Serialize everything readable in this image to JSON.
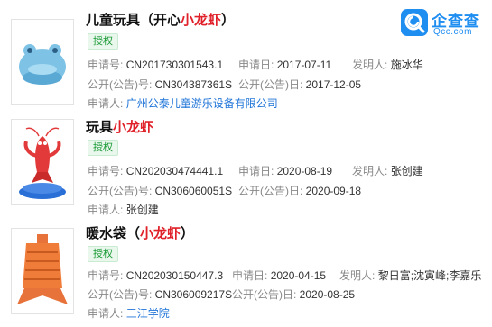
{
  "brand": {
    "name_cn": "企查查",
    "name_en": "Qcc.com",
    "color": "#1f8ef1"
  },
  "results": [
    {
      "title_pre": "儿童玩具（开心",
      "title_hl": "小龙虾",
      "title_post": "）",
      "badge": "授权",
      "app_no_label": "申请号:",
      "app_no": "CN201730301543.1",
      "app_date_label": "申请日:",
      "app_date": "2017-07-11",
      "inventor_label": "发明人:",
      "inventor": "施冰华",
      "pub_no_label": "公开(公告)号:",
      "pub_no": "CN304387361S",
      "pub_date_label": "公开(公告)日:",
      "pub_date": "2017-12-05",
      "applicant_label": "申请人:",
      "applicant": "广州公泰儿童游乐设备有限公司"
    },
    {
      "title_pre": "玩具",
      "title_hl": "小龙虾",
      "title_post": "",
      "badge": "授权",
      "app_no_label": "申请号:",
      "app_no": "CN202030474441.1",
      "app_date_label": "申请日:",
      "app_date": "2020-08-19",
      "inventor_label": "发明人:",
      "inventor": "张创建",
      "pub_no_label": "公开(公告)号:",
      "pub_no": "CN306060051S",
      "pub_date_label": "公开(公告)日:",
      "pub_date": "2020-09-18",
      "applicant_label": "申请人:",
      "applicant": "张创建"
    },
    {
      "title_pre": "暖水袋（",
      "title_hl": "小龙虾",
      "title_post": "）",
      "badge": "授权",
      "app_no_label": "申请号:",
      "app_no": "CN202030150447.3",
      "app_date_label": "申请日:",
      "app_date": "2020-04-15",
      "inventor_label": "发明人:",
      "inventor": "黎日富;沈寅峰;李嘉乐",
      "pub_no_label": "公开(公告)号:",
      "pub_no": "CN306009217S",
      "pub_date_label": "公开(公告)日:",
      "pub_date": "2020-08-25",
      "applicant_label": "申请人:",
      "applicant": "三江学院"
    }
  ]
}
